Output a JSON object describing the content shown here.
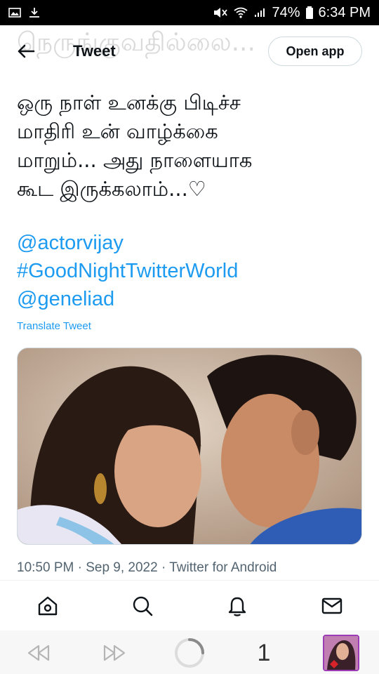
{
  "status_bar": {
    "battery": "74%",
    "time": "6:34 PM"
  },
  "header": {
    "ghost_text": "நெருங்குவதில்லை...",
    "title": "Tweet",
    "open_app_label": "Open app"
  },
  "tweet": {
    "text": "ஒரு நாள் உனக்கு பிடிச்ச\nமாதிரி உன் வாழ்க்கை\nமாறும்... அது நாளையாக\nகூட இருக்கலாம்...♡",
    "links": [
      "@actorvijay",
      "#GoodNightTwitterWorld",
      "@geneliad"
    ],
    "translate_label": "Translate Tweet",
    "meta": "10:50 PM · Sep 9, 2022 · Twitter for Android"
  },
  "bottom_nav": {
    "icons": [
      "home-icon",
      "search-icon",
      "notifications-icon",
      "messages-icon"
    ]
  },
  "browser_bar": {
    "tab_count": "1"
  },
  "colors": {
    "link": "#1d9bf0",
    "text": "#0f1419",
    "muted": "#536471"
  }
}
